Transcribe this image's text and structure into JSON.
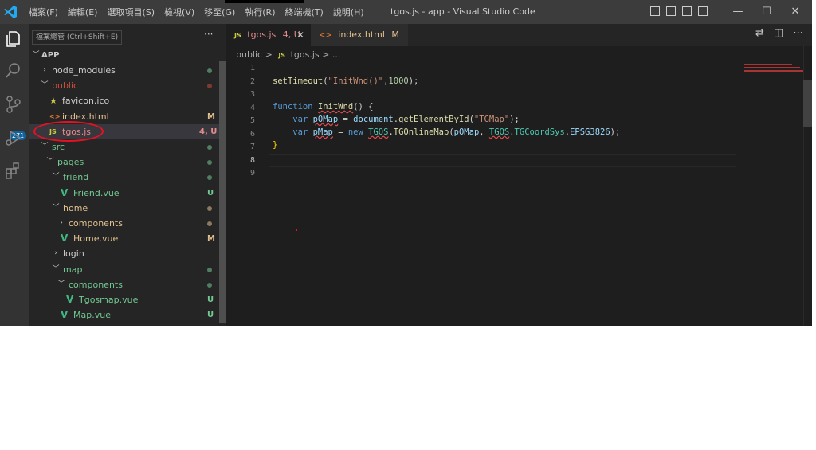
{
  "titlebar": {
    "menus": [
      "檔案(F)",
      "編輯(E)",
      "選取項目(S)",
      "檢視(V)",
      "移至(G)",
      "執行(R)",
      "終端機(T)",
      "說明(H)"
    ],
    "title": "tgos.js - app - Visual Studio Code",
    "controls": {
      "minimize": "—",
      "maximize": "☐",
      "close": "✕"
    }
  },
  "activity": {
    "badge": "271"
  },
  "sidebar": {
    "tooltip": "檔案總管 (Ctrl+Shift+E)",
    "more": "···",
    "root": "APP",
    "tree": [
      {
        "label": "node_modules",
        "type": "folder",
        "expanded": false,
        "depth": 1,
        "status": "dot",
        "color": "#73c991"
      },
      {
        "label": "public",
        "type": "folder",
        "expanded": true,
        "depth": 1,
        "status": "dot",
        "color": "#c74e39",
        "labelColor": "#c74e39"
      },
      {
        "label": "favicon.ico",
        "type": "file",
        "icon": "★",
        "iconColor": "#cbcb41",
        "depth": 2,
        "status": "",
        "labelColor": "#cccccc"
      },
      {
        "label": "index.html",
        "type": "file",
        "icon": "<>",
        "iconColor": "#e37933",
        "depth": 2,
        "status": "M",
        "color": "#e2c08d",
        "labelColor": "#e2c08d"
      },
      {
        "label": "tgos.js",
        "type": "file",
        "icon": "JS",
        "iconColor": "#cbcb41",
        "depth": 2,
        "status": "4, U",
        "color": "#e28c8c",
        "labelColor": "#e28c8c",
        "selected": true
      },
      {
        "label": "src",
        "type": "folder",
        "expanded": true,
        "depth": 1,
        "status": "dot",
        "color": "#73c991",
        "labelColor": "#73c991"
      },
      {
        "label": "pages",
        "type": "folder",
        "expanded": true,
        "depth": 2,
        "status": "dot",
        "color": "#73c991",
        "labelColor": "#73c991"
      },
      {
        "label": "friend",
        "type": "folder",
        "expanded": true,
        "depth": 3,
        "status": "dot",
        "color": "#73c991",
        "labelColor": "#73c991"
      },
      {
        "label": "Friend.vue",
        "type": "file",
        "icon": "V",
        "iconColor": "#41b883",
        "depth": 4,
        "status": "U",
        "color": "#73c991",
        "labelColor": "#73c991"
      },
      {
        "label": "home",
        "type": "folder",
        "expanded": true,
        "depth": 3,
        "status": "dot",
        "color": "#e2c08d",
        "labelColor": "#e2c08d"
      },
      {
        "label": "components",
        "type": "folder",
        "expanded": false,
        "depth": 4,
        "status": "dot",
        "color": "#e2c08d",
        "labelColor": "#e2c08d"
      },
      {
        "label": "Home.vue",
        "type": "file",
        "icon": "V",
        "iconColor": "#41b883",
        "depth": 4,
        "status": "M",
        "color": "#e2c08d",
        "labelColor": "#e2c08d"
      },
      {
        "label": "login",
        "type": "folder",
        "expanded": false,
        "depth": 3,
        "status": "",
        "labelColor": "#cccccc"
      },
      {
        "label": "map",
        "type": "folder",
        "expanded": true,
        "depth": 3,
        "status": "dot",
        "color": "#73c991",
        "labelColor": "#73c991"
      },
      {
        "label": "components",
        "type": "folder",
        "expanded": true,
        "depth": 4,
        "status": "dot",
        "color": "#73c991",
        "labelColor": "#73c991"
      },
      {
        "label": "Tgosmap.vue",
        "type": "file",
        "icon": "V",
        "iconColor": "#41b883",
        "depth": 5,
        "status": "U",
        "color": "#73c991",
        "labelColor": "#73c991"
      },
      {
        "label": "Map.vue",
        "type": "file",
        "icon": "V",
        "iconColor": "#41b883",
        "depth": 4,
        "status": "U",
        "color": "#73c991",
        "labelColor": "#73c991"
      }
    ]
  },
  "tabs": [
    {
      "label": "tgos.js",
      "status": "4, U",
      "icon": "JS",
      "active": true,
      "close": "✕"
    },
    {
      "label": "index.html",
      "status": "M",
      "icon": "<>",
      "active": false
    }
  ],
  "breadcrumb": {
    "folder": "public",
    "sep1": ">",
    "icon": "JS",
    "file": "tgos.js",
    "sep2": ">",
    "tail": "..."
  },
  "editor": {
    "line_numbers": [
      "1",
      "2",
      "3",
      "4",
      "5",
      "6",
      "7",
      "8",
      "9"
    ],
    "current_line": "8",
    "code": {
      "l2": {
        "fn": "setTimeout",
        "p1": "(",
        "str": "\"InitWnd()\"",
        "p2": ",",
        "num": "1000",
        "p3": ");"
      },
      "l4": {
        "kw": "function",
        "fn": "InitWnd",
        "p": "() {"
      },
      "l5": {
        "kw": "var",
        "var": "pOMap",
        "eq": " = ",
        "obj": "document",
        "dot": ".",
        "fn": "getElementById",
        "p1": "(",
        "str": "\"TGMap\"",
        "p2": ");"
      },
      "l6": {
        "kw": "var",
        "var": "pMap",
        "eq": " = ",
        "kw2": "new",
        "cls1": "TGOS",
        "dot1": ".",
        "fn": "TGOnlineMap",
        "p1": "(",
        "arg1": "pOMap",
        "comma": ", ",
        "cls2": "TGOS",
        "dot2": ".",
        "cls3": "TGCoordSys",
        "dot3": ".",
        "prop": "EPSG3826",
        "p2": ");"
      },
      "l7": {
        "p": "}"
      }
    }
  },
  "colors": {
    "accent": "#007acc",
    "annotation": "#e81123",
    "background": "#1e1e1e"
  }
}
